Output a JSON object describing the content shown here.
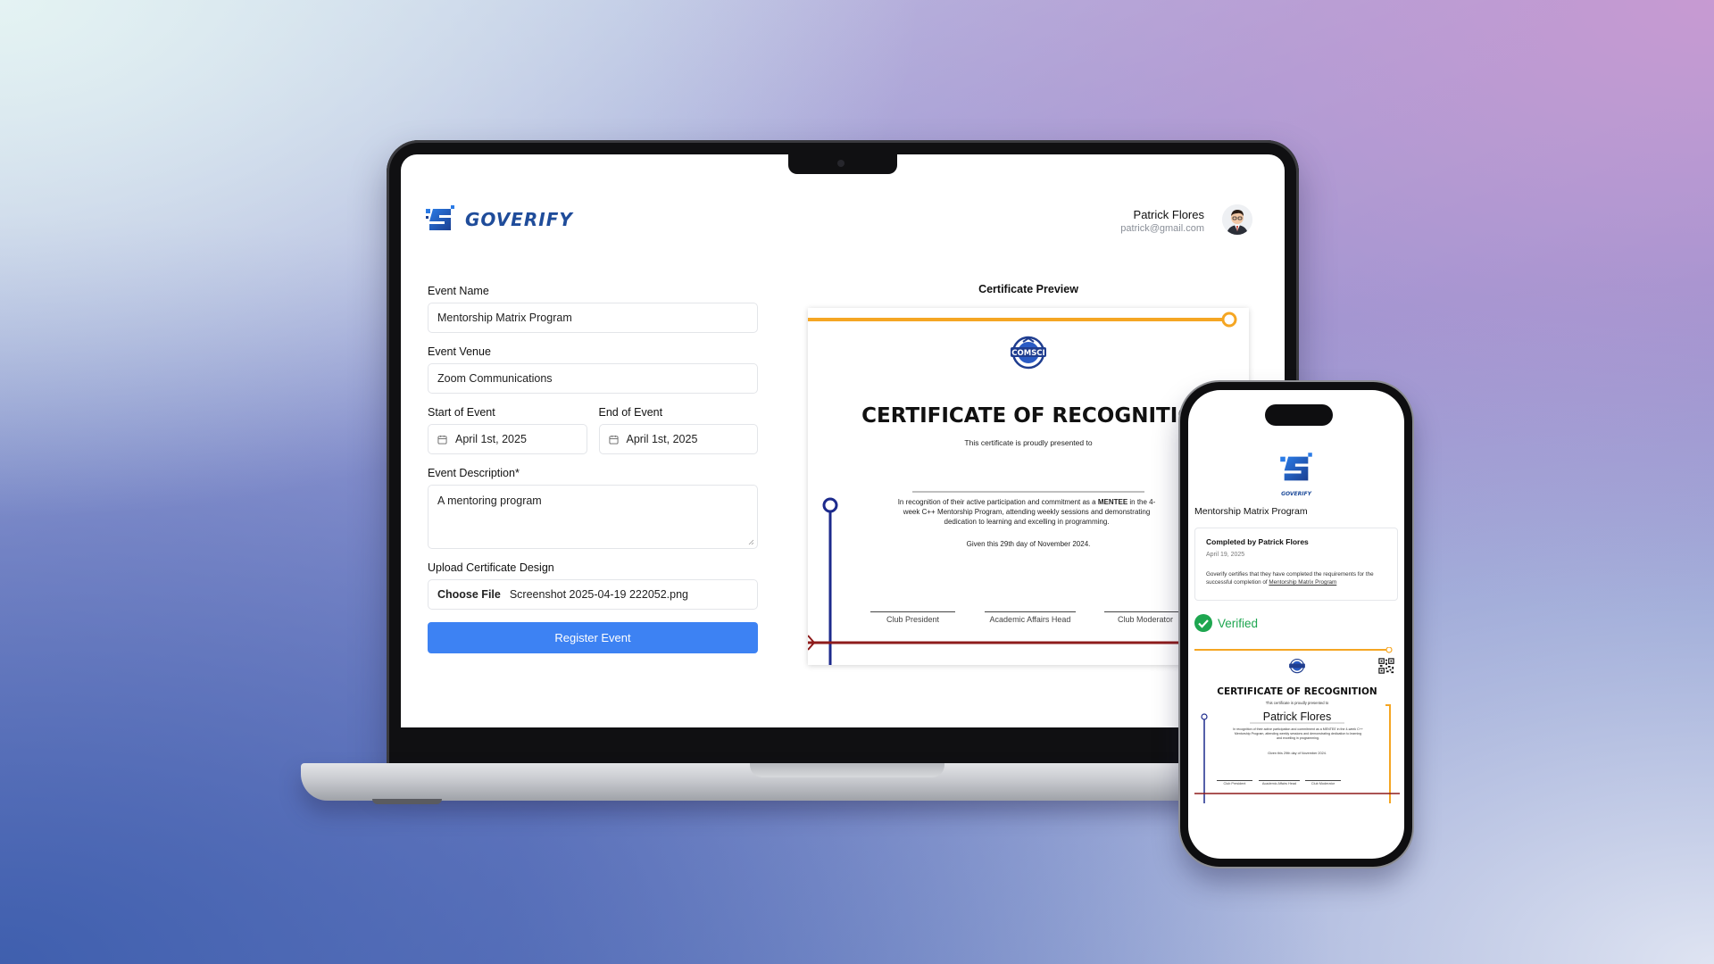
{
  "app": {
    "logo_text": "GOVERIFY",
    "user": {
      "name": "Patrick Flores",
      "email": "patrick@gmail.com"
    }
  },
  "form": {
    "event_name": {
      "label": "Event Name",
      "value": "Mentorship Matrix Program"
    },
    "event_venue": {
      "label": "Event Venue",
      "value": "Zoom Communications"
    },
    "start_event": {
      "label": "Start of Event",
      "value": "April 1st, 2025"
    },
    "end_event": {
      "label": "End of Event",
      "value": "April 1st, 2025"
    },
    "description": {
      "label": "Event Description*",
      "value": "A mentoring program"
    },
    "upload": {
      "label": "Upload Certificate Design",
      "button": "Choose File",
      "file_name": "Screenshot 2025-04-19 222052.png"
    },
    "submit_label": "Register Event"
  },
  "preview": {
    "heading": "Certificate Preview",
    "certificate": {
      "title": "CERTIFICATE OF RECOGNITIO",
      "subtitle": "This certificate is proudly presented to",
      "body_pre": "In recognition of their active participation and commitment as a ",
      "body_bold": "MENTEE",
      "body_post": " in the 4-week C++ Mentorship Program, attending weekly sessions and demonstrating dedication to learning and excelling in programming.",
      "given": "Given this 29th day of November 2024.",
      "signatures": [
        "Club President",
        "Academic Affairs Head",
        "Club Moderator"
      ]
    }
  },
  "phone": {
    "logo_text": "GOVERIFY",
    "event_title": "Mentorship Matrix Program",
    "card": {
      "completed_by": "Completed by Patrick Flores",
      "date": "April 19, 2025",
      "text_pre": "Goverify certifies that they have completed the requirements for the successful completion of ",
      "text_link": "Mentorship Matrix Program"
    },
    "verified_label": "Verified",
    "certificate": {
      "title": "CERTIFICATE OF RECOGNITION",
      "subtitle": "This certificate is proudly presented to",
      "recipient": "Patrick Flores",
      "body": "In recognition of their active participation and commitment as a MENTEE in the 4-week C++ Mentorship Program, attending weekly sessions and demonstrating dedication to learning and excelling in programming.",
      "given": "Given this 29th day of November 2024.",
      "signatures": [
        "Club President",
        "Academic Affairs Head",
        "Club Moderator"
      ]
    }
  },
  "colors": {
    "primary": "#3d82f3",
    "brand": "#1f4c9a",
    "orange": "#f5a623",
    "navy": "#1c2a8c",
    "maroon": "#8e1b1b",
    "verified": "#1ea650"
  },
  "icons": {
    "calendar": "calendar-icon",
    "check": "check-circle-icon",
    "qr": "qr-code-icon"
  }
}
